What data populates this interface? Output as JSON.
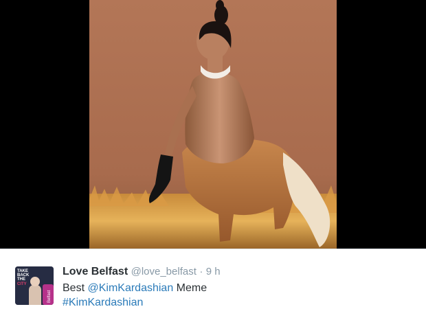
{
  "tweet": {
    "display_name": "Love Belfast",
    "handle": "@love_belfast",
    "separator": "·",
    "time": "9 h",
    "text_prefix": "Best ",
    "mention": "@KimKardashian",
    "text_suffix": " Meme",
    "hashtag": "#KimKardashian",
    "avatar_text_top": [
      "TAKE",
      "BACK",
      "THE",
      "CITY"
    ],
    "avatar_text_side": "Belfast"
  },
  "media": {
    "description_icon": "photo-icon"
  },
  "colors": {
    "background": "#ffffff",
    "link": "#2b7bb9",
    "name": "#292f33",
    "meta": "#8899a6",
    "media_bg": "#000000",
    "backdrop": "#b07454"
  }
}
